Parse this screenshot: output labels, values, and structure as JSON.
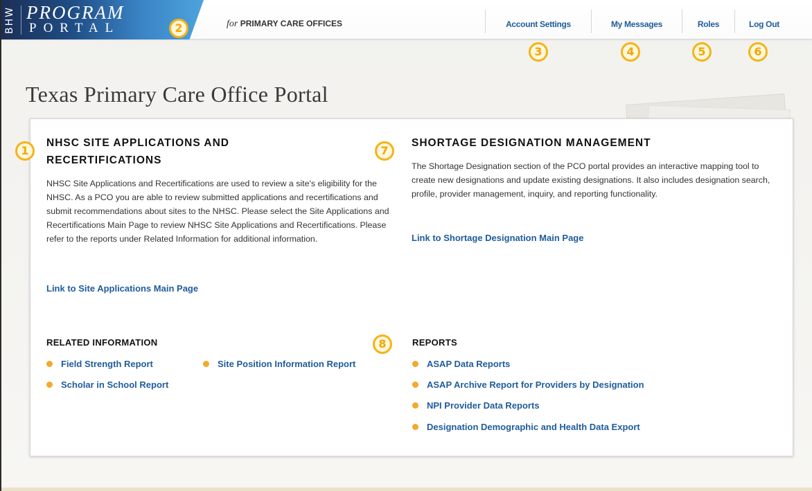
{
  "header": {
    "logo": {
      "agency": "BHW",
      "program": "PROGRAM",
      "portal": "PORTAL"
    },
    "tagline_for": "for",
    "tagline_org": "PRIMARY CARE OFFICES",
    "nav": [
      "Account Settings",
      "My Messages",
      "Roles",
      "Log Out"
    ]
  },
  "page_title": "Texas Primary Care Office Portal",
  "callouts": [
    "1",
    "2",
    "3",
    "4",
    "5",
    "6",
    "7",
    "8"
  ],
  "nhsc": {
    "heading_line1": "NHSC SITE APPLICATIONS AND",
    "heading_line2": "RECERTIFICATIONS",
    "body": "NHSC Site Applications and Recertifications are used to review a site's eligibility for the NHSC. As a PCO you are able to review submitted applications and recertifications and submit recommendations about sites to the NHSC. Please select the Site Applications and Recertifications Main Page to review NHSC Site Applications and Recertifications. Please refer to the reports under Related Information for additional information.",
    "link": "Link to Site Applications Main Page"
  },
  "shortage": {
    "heading": "SHORTAGE DESIGNATION MANAGEMENT",
    "body": "The Shortage Designation section of the PCO portal provides an interactive mapping tool to create new designations and update existing designations. It also includes designation search, profile, provider management, inquiry, and reporting functionality.",
    "link": "Link to Shortage Designation Main Page"
  },
  "related": {
    "heading": "RELATED INFORMATION",
    "items": [
      "Field Strength Report",
      "Site Position Information Report",
      "Scholar in School Report"
    ]
  },
  "reports": {
    "heading": "REPORTS",
    "items": [
      "ASAP Data Reports",
      "ASAP Archive Report for Providers by Designation",
      "NPI Provider Data Reports",
      "Designation Demographic and Health Data Export"
    ]
  },
  "colors": {
    "link": "#1f5c9a",
    "callout": "#f3b41a",
    "bullet": "#f3a92c"
  }
}
